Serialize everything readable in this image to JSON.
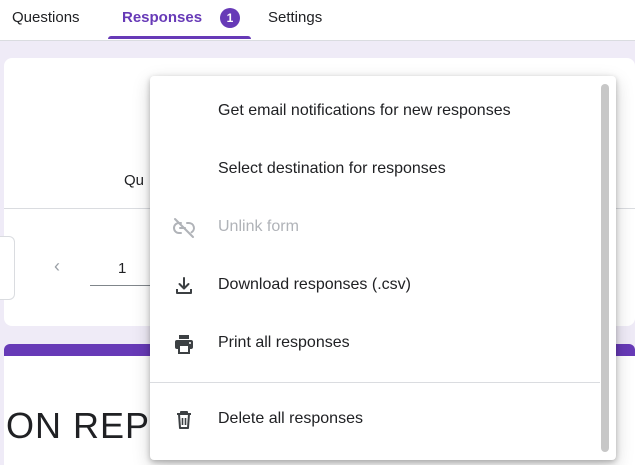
{
  "tabs": {
    "questions": "Questions",
    "responses": "Responses",
    "responses_count": "1",
    "settings": "Settings"
  },
  "background": {
    "question_label": "Qu",
    "page_number": "1",
    "title_fragment": "ON REPO"
  },
  "menu": {
    "items": [
      {
        "label": "Get email notifications for new responses",
        "icon": "none",
        "disabled": false
      },
      {
        "label": "Select destination for responses",
        "icon": "none",
        "disabled": false
      },
      {
        "label": "Unlink form",
        "icon": "unlink-icon",
        "disabled": true
      },
      {
        "label": "Download responses (.csv)",
        "icon": "download-icon",
        "disabled": false
      },
      {
        "label": "Print all responses",
        "icon": "print-icon",
        "disabled": false
      },
      {
        "label": "Delete all responses",
        "icon": "trash-icon",
        "disabled": false
      }
    ]
  },
  "colors": {
    "accent": "#673ab7",
    "background": "#efebf7",
    "disabled_text": "#b0b3b8"
  }
}
